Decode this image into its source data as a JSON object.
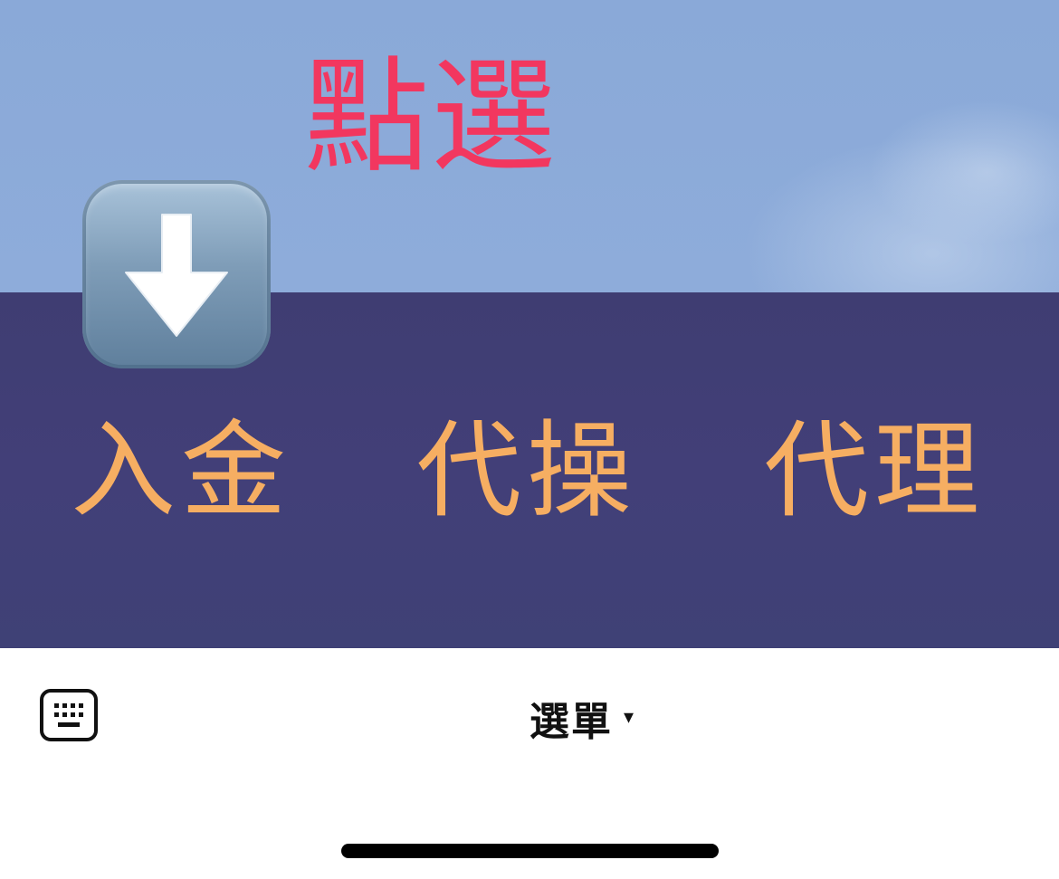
{
  "annotation": {
    "text": "點選",
    "color": "#f2375f"
  },
  "arrow_emoji": {
    "icon": "down-arrow-icon"
  },
  "rich_menu": {
    "background": "#403e75",
    "text_color": "#f6ae62",
    "items": [
      {
        "label": "入金"
      },
      {
        "label": "代操"
      },
      {
        "label": "代理"
      }
    ]
  },
  "chat_bar": {
    "keyboard_icon": "keyboard-icon",
    "menu_label": "選單",
    "menu_caret": "▾"
  }
}
